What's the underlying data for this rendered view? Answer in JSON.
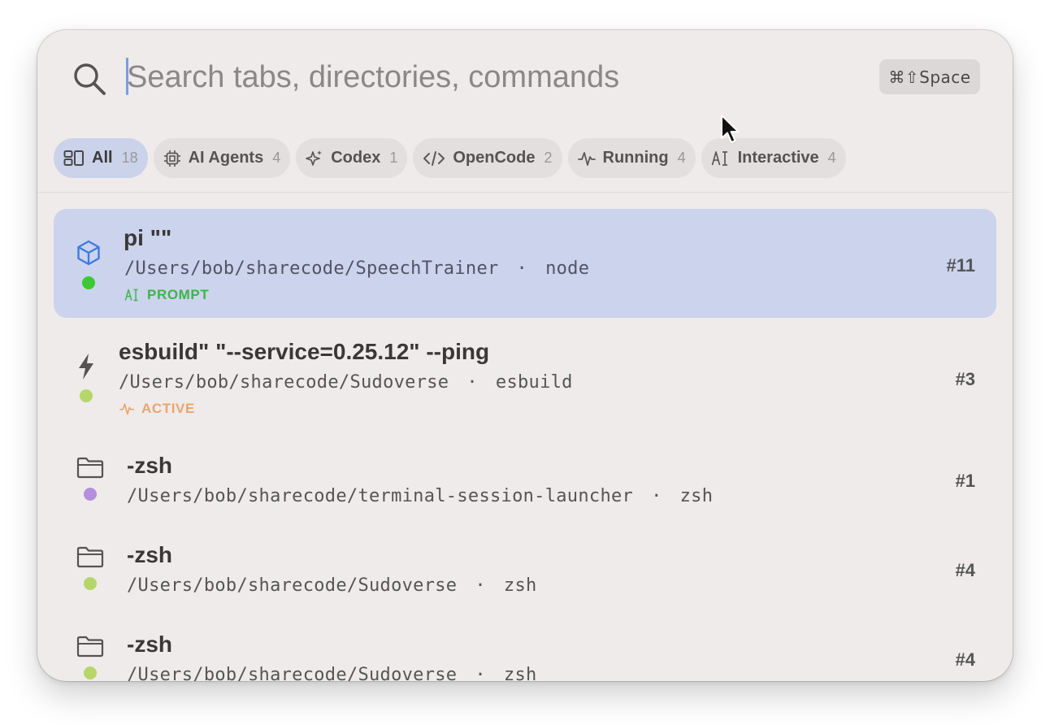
{
  "search": {
    "placeholder": "Search tabs, directories, commands",
    "shortcut": "⌘⇧Space"
  },
  "filters": [
    {
      "label": "All",
      "count": "18",
      "icon": "layout-icon",
      "active": true
    },
    {
      "label": "AI Agents",
      "count": "4",
      "icon": "cpu-chip-icon",
      "active": false
    },
    {
      "label": "Codex",
      "count": "1",
      "icon": "sparkle-icon",
      "active": false
    },
    {
      "label": "OpenCode",
      "count": "2",
      "icon": "code-brackets-icon",
      "active": false
    },
    {
      "label": "Running",
      "count": "4",
      "icon": "activity-pulse-icon",
      "active": false
    },
    {
      "label": "Interactive",
      "count": "4",
      "icon": "text-cursor-icon",
      "active": false
    }
  ],
  "rows": [
    {
      "title": "pi \"\"",
      "path": "/Users/bob/sharecode/SpeechTrainer",
      "separator": "·",
      "process": "node",
      "tab": "#11",
      "status": "PROMPT",
      "icon": "cube-icon",
      "dot_color": "#3bc934",
      "status_color": "#3fb44a",
      "selected": true
    },
    {
      "title": "esbuild\" \"--service=0.25.12\" --ping",
      "path": "/Users/bob/sharecode/Sudoverse",
      "separator": "·",
      "process": "esbuild",
      "tab": "#3",
      "status": "ACTIVE",
      "icon": "lightning-icon",
      "dot_color": "#b6d66a",
      "status_color": "#e8a66e",
      "selected": false
    },
    {
      "title": "-zsh",
      "path": "/Users/bob/sharecode/terminal-session-launcher",
      "separator": "·",
      "process": "zsh",
      "tab": "#1",
      "status": "",
      "icon": "folder-icon",
      "dot_color": "#b48fdb",
      "selected": false
    },
    {
      "title": "-zsh",
      "path": "/Users/bob/sharecode/Sudoverse",
      "separator": "·",
      "process": "zsh",
      "tab": "#4",
      "status": "",
      "icon": "folder-icon",
      "dot_color": "#b6d66a",
      "selected": false
    },
    {
      "title": "-zsh",
      "path": "/Users/bob/sharecode/Sudoverse",
      "separator": "·",
      "process": "zsh",
      "tab": "#4",
      "status": "",
      "icon": "folder-icon",
      "dot_color": "#b6d66a",
      "selected": false
    }
  ]
}
